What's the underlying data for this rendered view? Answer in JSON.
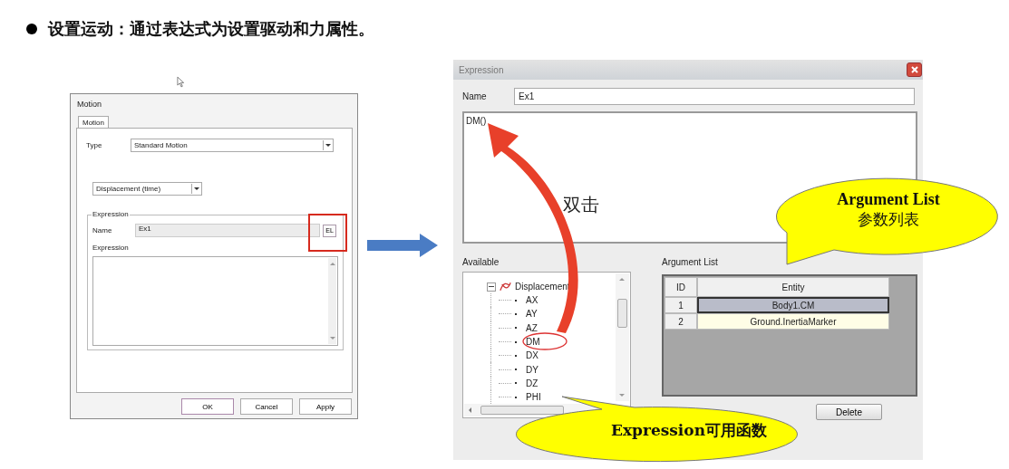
{
  "bullet": "设置运动：通过表达式为设置驱动和力属性。",
  "motion_dialog": {
    "title": "Motion",
    "tabs": [
      {
        "label": "Motion",
        "selected": true
      }
    ],
    "type_label": "Type",
    "type_value": "Standard Motion",
    "mode_value": "Displacement (time)",
    "group_title": "Expression",
    "name_label": "Name",
    "name_value": "Ex1",
    "el_button": "EL",
    "expression_label": "Expression",
    "buttons": [
      "OK",
      "Cancel",
      "Apply"
    ]
  },
  "expression_dialog": {
    "title": "Expression",
    "name_label": "Name",
    "name_value": "Ex1",
    "expression_value": "DM()",
    "available_label": "Available",
    "tree": [
      {
        "label": "Displacement",
        "expanded": true,
        "children": [
          {
            "label": "AX"
          },
          {
            "label": "AY"
          },
          {
            "label": "AZ"
          },
          {
            "label": "DM"
          },
          {
            "label": "DX"
          },
          {
            "label": "DY"
          },
          {
            "label": "DZ"
          },
          {
            "label": "PHI"
          }
        ]
      }
    ],
    "argument_label": "Argument List",
    "columns": [
      "ID",
      "Entity"
    ],
    "rows": [
      {
        "id": "1",
        "entity": "Body1.CM",
        "selected": true
      },
      {
        "id": "2",
        "entity": "Ground.InertiaMarker",
        "selected": false
      }
    ],
    "delete_button": "Delete"
  },
  "annotations": {
    "double_click": "双击",
    "argument_callout": {
      "title": "Argument List",
      "subtitle": "参数列表"
    },
    "available_callout": "Expression可用函数"
  }
}
